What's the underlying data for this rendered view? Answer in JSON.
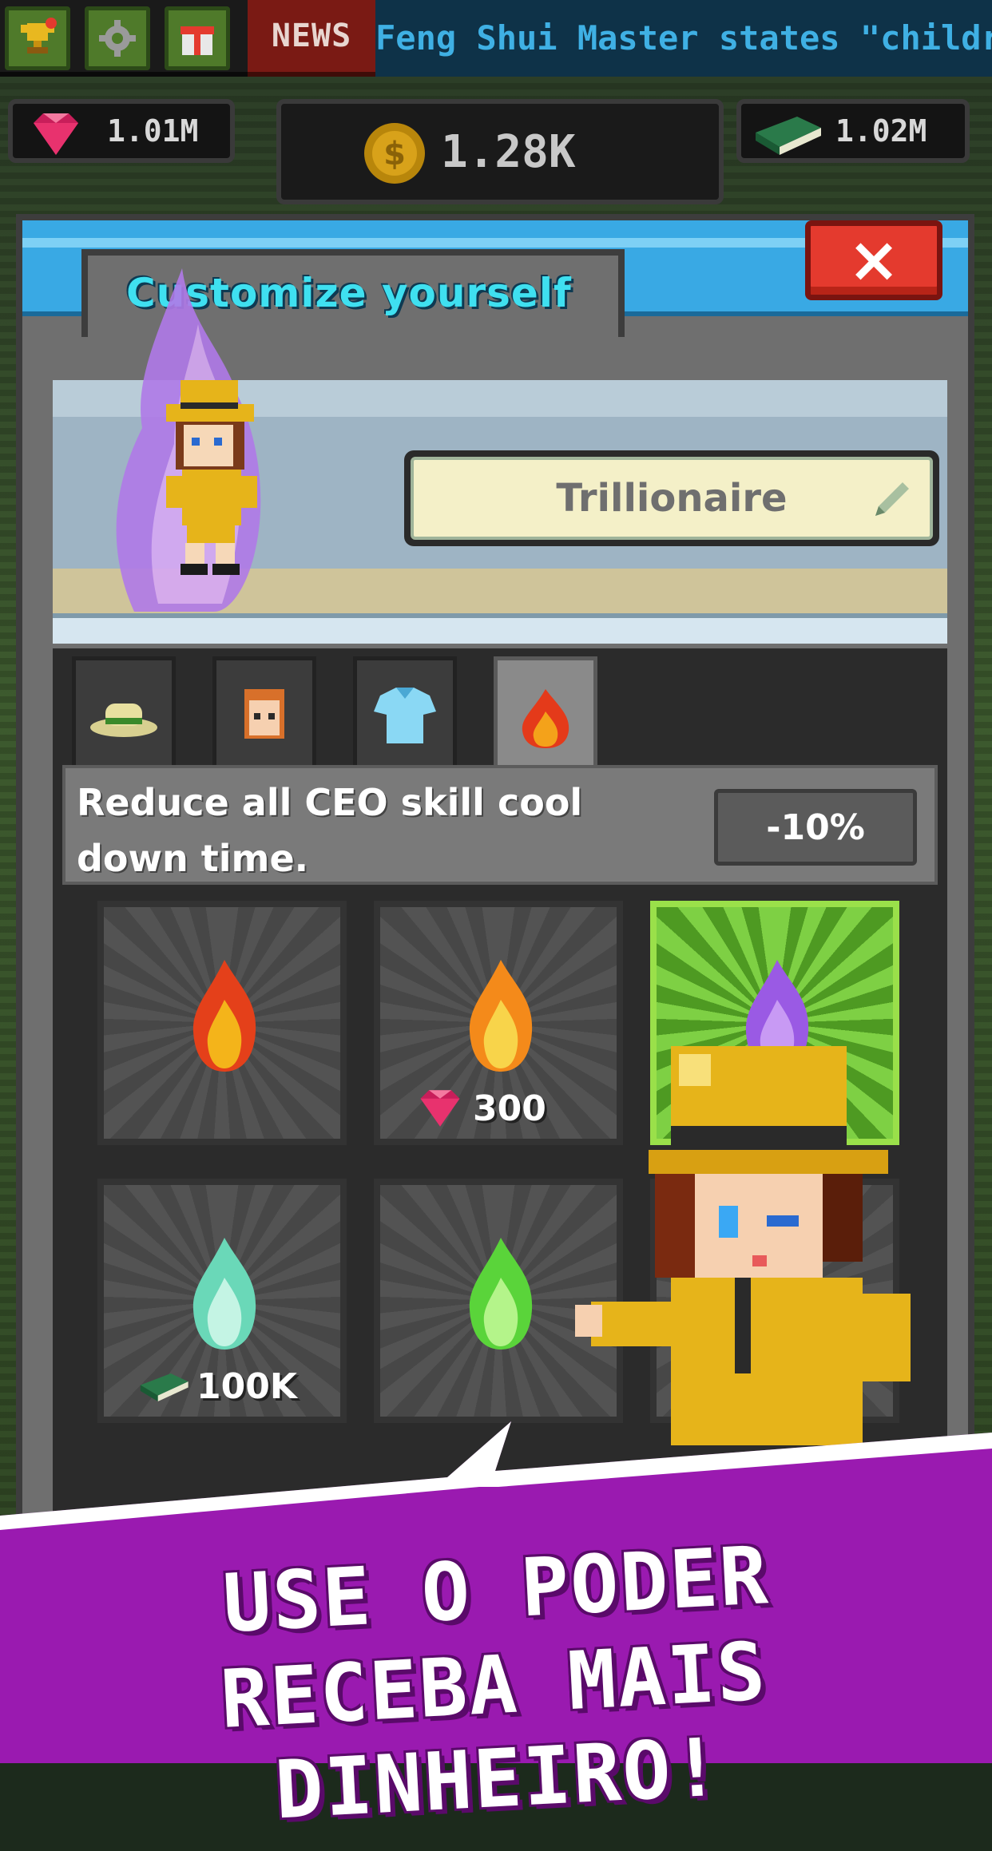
{
  "news": {
    "tag": "NEWS",
    "ticker": "Feng Shui Master states \"children"
  },
  "currency": {
    "gems": "1.01M",
    "coins": "1.28K",
    "books": "1.02M"
  },
  "dialog": {
    "title": "Customize yourself",
    "close_label": "×",
    "name_value": "Trillionaire",
    "tabs": [
      {
        "label": "hat-tab",
        "icon": "hat-icon"
      },
      {
        "label": "face-tab",
        "icon": "face-icon"
      },
      {
        "label": "shirt-tab",
        "icon": "shirt-icon"
      },
      {
        "label": "aura-tab",
        "icon": "flame-icon",
        "active": true
      }
    ],
    "description": "Reduce all CEO skill cool down time.",
    "bonus_value": "-10%",
    "items": [
      {
        "flame_color": "#f4701a",
        "price": ""
      },
      {
        "flame_color": "#f49a1a",
        "price": "300",
        "currency_icon": "gem-icon"
      },
      {
        "flame_color": "#a06ae4",
        "price": "",
        "selected": true
      },
      {
        "flame_color": "#7ee4c4",
        "price": "100K",
        "currency_icon": "book-icon"
      },
      {
        "flame_color": "#6ae44a",
        "price": ""
      }
    ]
  },
  "promo": {
    "line1": "USE O PODER",
    "line2": "RECEBA MAIS DINHEIRO!"
  }
}
